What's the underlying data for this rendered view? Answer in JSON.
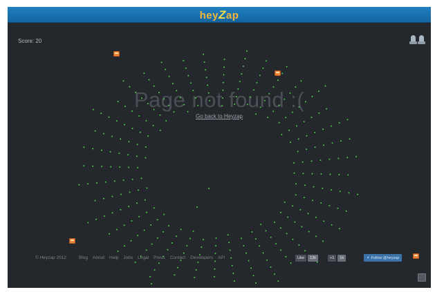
{
  "header": {
    "logo_prefix": "hey",
    "logo_z": "Z",
    "logo_suffix": "ap"
  },
  "hud": {
    "score_label": "Score: 20",
    "lives": 2
  },
  "main": {
    "title": "Page not found :(",
    "back_link": "Go back to Heyzap"
  },
  "footer": {
    "copyright": "© Heyzap 2012",
    "links": [
      "Blog",
      "About",
      "Help",
      "Jobs",
      "Legal",
      "Press",
      "Contact",
      "Developers",
      "API"
    ],
    "like": {
      "label": "Like",
      "count": "13k"
    },
    "plusone": {
      "label": "+1",
      "count": "1k"
    },
    "follow": "Follow @heyzap"
  },
  "colors": {
    "background": "#24272b",
    "header": "#1f7fc1",
    "bullet": "#4bd24b",
    "enemy": "#e9843a"
  },
  "icons": {
    "lives": "rocket-ship-icon",
    "enemy": "alien-invader-icon",
    "corner": "fullscreen-icon"
  }
}
